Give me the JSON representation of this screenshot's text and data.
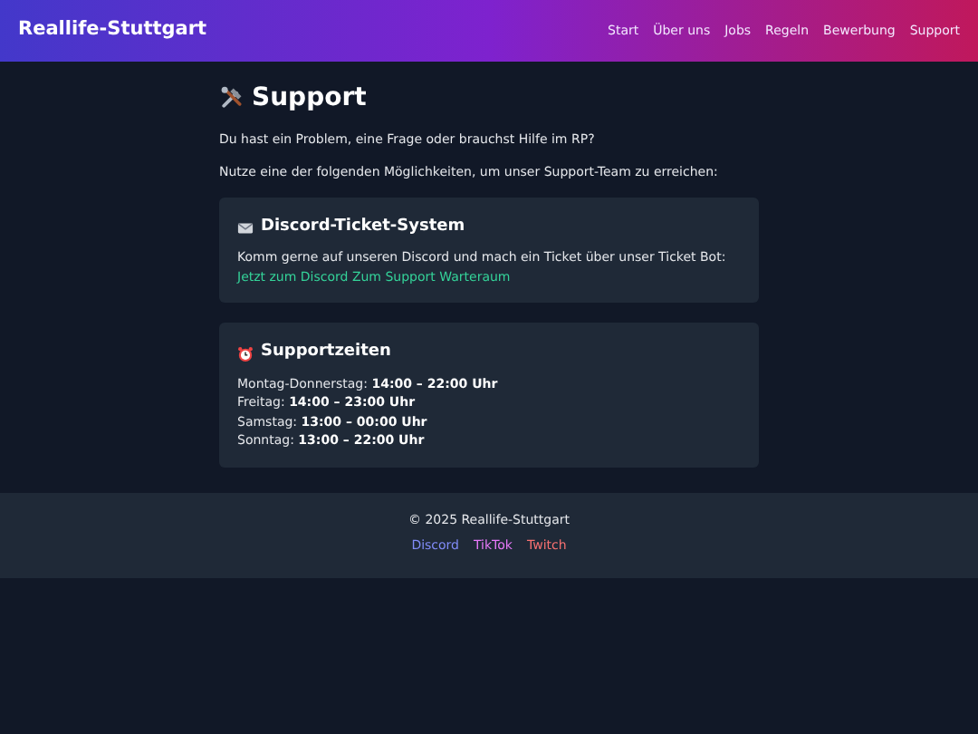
{
  "navbar": {
    "brand": "Reallife-Stuttgart",
    "links": [
      "Start",
      "Über uns",
      "Jobs",
      "Regeln",
      "Bewerbung",
      "Support"
    ]
  },
  "page": {
    "title": "Support",
    "intro": [
      "Du hast ein Problem, eine Frage oder brauchst Hilfe im RP?",
      "Nutze eine der folgenden Möglichkeiten, um unser Support-Team zu erreichen:"
    ]
  },
  "cards": [
    {
      "kind": "ticket",
      "title": "Discord-Ticket-System",
      "lines": [
        "Komm gerne auf unseren Discord und mach ein Ticket über unser Ticket Bot:"
      ],
      "link": "Jetzt zum Discord Zum Support Warteraum"
    },
    {
      "kind": "hours",
      "title": "Supportzeiten",
      "lines": [
        "Montag-Donnerstag: **14:00 – 22:00 Uhr**",
        "Freitag: **14:00 – 23:00 Uhr**",
        "Samstag: **13:00 – 00:00 Uhr**",
        "Sonntag: **13:00 – 22:00 Uhr**"
      ]
    }
  ],
  "footer": {
    "copyright": "© 2025 Reallife-Stuttgart",
    "links": [
      {
        "label": "Discord",
        "color": "#818cf8"
      },
      {
        "label": "TikTok",
        "color": "#e879f9"
      },
      {
        "label": "Twitch",
        "color": "#f87171"
      }
    ]
  }
}
